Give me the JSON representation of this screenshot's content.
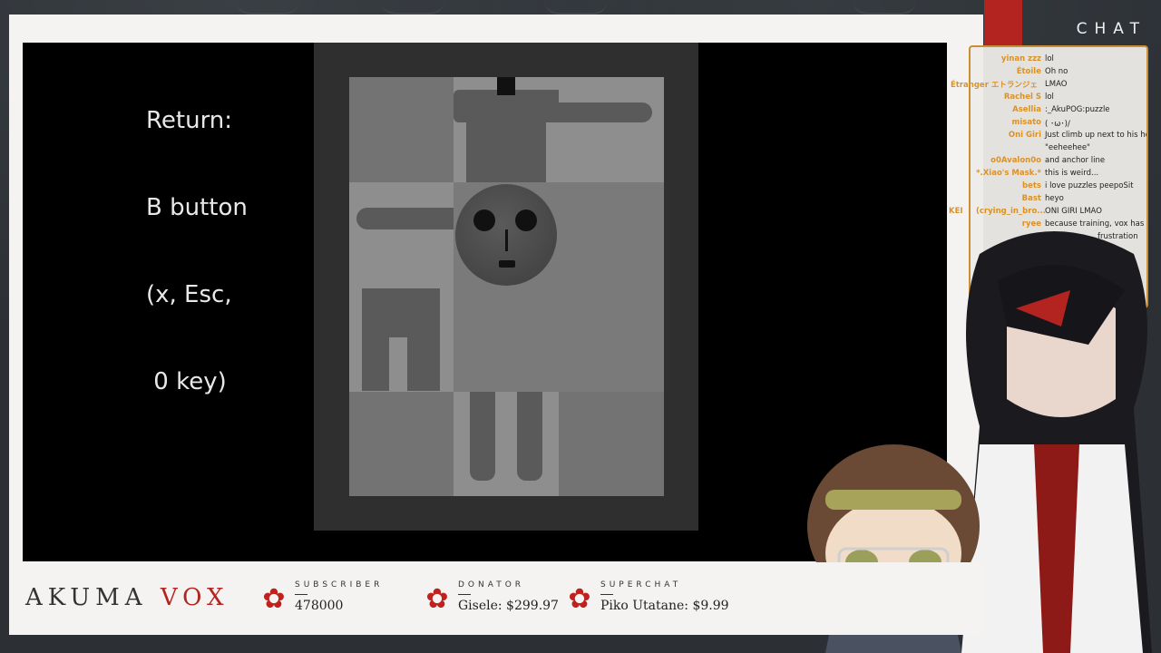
{
  "game": {
    "instructions": [
      "Return:",
      "B button",
      "(x, Esc,",
      " 0 key)"
    ]
  },
  "chat": {
    "title": "CHAT",
    "messages": [
      {
        "name": "yinan zzz",
        "text": "lol"
      },
      {
        "name": "Étoile",
        "text": "Oh no"
      },
      {
        "name": "Étranger エトランジェ",
        "text": "LMAO"
      },
      {
        "name": "Rachel S",
        "text": "lol"
      },
      {
        "name": "Asellia",
        "text": ":_AkuPOG:puzzle"
      },
      {
        "name": "misato",
        "text": "( ･ω･)/"
      },
      {
        "name": "Oni Giri",
        "text": "Just climb up next to his hea"
      },
      {
        "name": "",
        "text": "\"eeheehee\""
      },
      {
        "name": "o0Avalon0o",
        "text": "and anchor line"
      },
      {
        "name": "*.Xiao's Mask.*",
        "text": "this is weird..."
      },
      {
        "name": "bets",
        "text": "i love puzzles peepoSit"
      },
      {
        "name": "Bast",
        "text": "heyo"
      },
      {
        "name": "(crying_in_bro...",
        "text": "ONI GIRI LMAO"
      },
      {
        "name": "ryee",
        "text": "because training, vox has"
      },
      {
        "name": "",
        "text": "frustration"
      }
    ],
    "outside_name": "KEI"
  },
  "bottom": {
    "brand_left": "AKUMA",
    "brand_right": "VOX",
    "stats": [
      {
        "label": "SUBSCRIBER",
        "value": "478000"
      },
      {
        "label": "DONATOR",
        "value": "Gisele: $299.97"
      },
      {
        "label": "SUPERCHAT",
        "value": "Piko Utatane: $9.99"
      }
    ]
  },
  "colors": {
    "accent_red": "#b3231f",
    "gold_border": "#c98f32",
    "chat_name": "#d9922a"
  },
  "icons": [
    "flower-icon",
    "badge-icon",
    "wrench-icon"
  ]
}
